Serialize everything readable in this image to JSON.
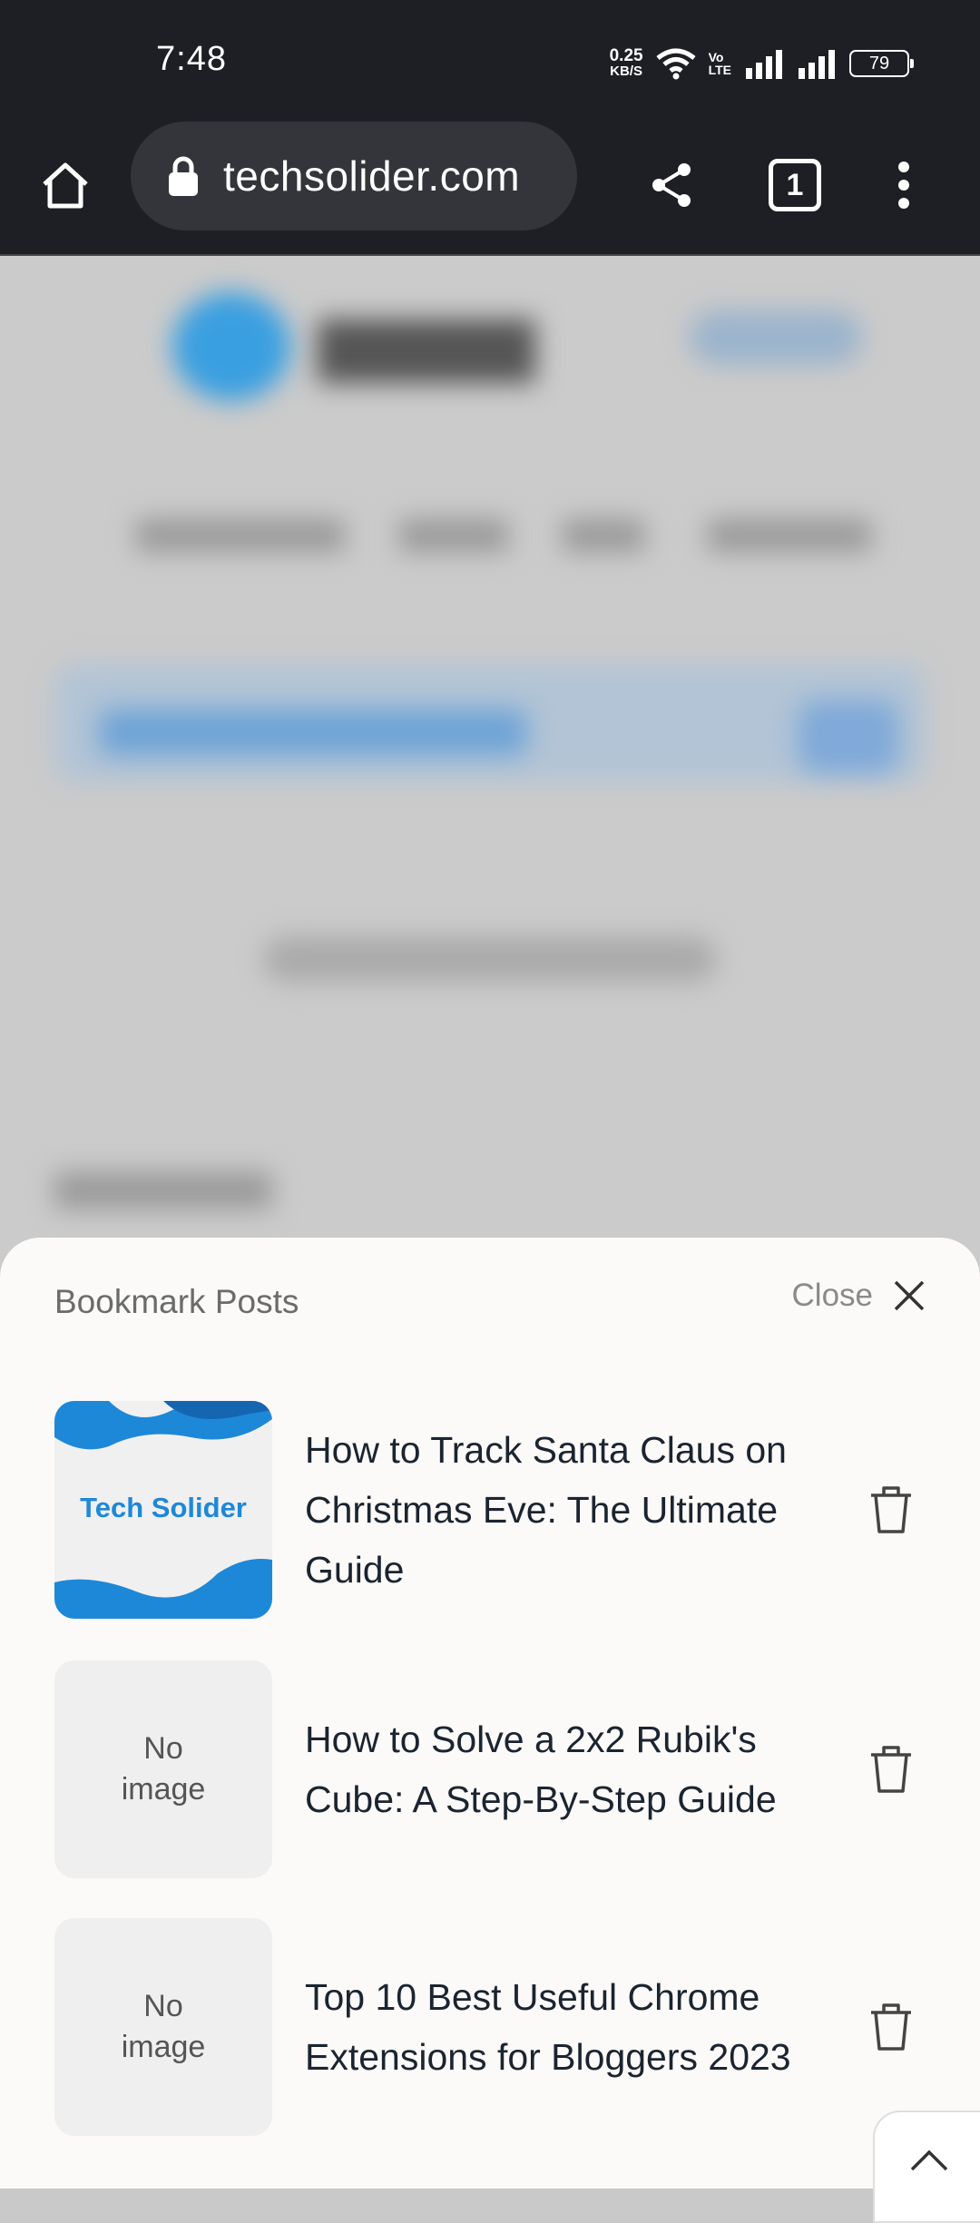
{
  "status_bar": {
    "time": "7:48",
    "net_speed_value": "0.25",
    "net_speed_unit": "KB/S",
    "volte_top": "Vo",
    "volte_bottom": "LTE",
    "battery": "79"
  },
  "browser": {
    "url": "techsolider.com",
    "tab_count": "1"
  },
  "bookmarks_sheet": {
    "title": "Bookmark Posts",
    "close_label": "Close",
    "items": [
      {
        "title": "How to Track Santa Claus on Christmas Eve: The Ultimate Guide",
        "thumbnail_text": "Tech Solider",
        "has_image": true
      },
      {
        "title": "How to Solve a 2x2 Rubik's Cube: A Step-By-Step Guide",
        "thumbnail_text": "No image",
        "has_image": false
      },
      {
        "title": "Top 10 Best Useful Chrome Extensions for Bloggers 2023",
        "thumbnail_text": "No image",
        "has_image": false
      }
    ]
  },
  "colors": {
    "chrome_dark": "#1e1f24",
    "accent_blue": "#1e88d8",
    "sheet_bg": "#fbfaf8"
  }
}
